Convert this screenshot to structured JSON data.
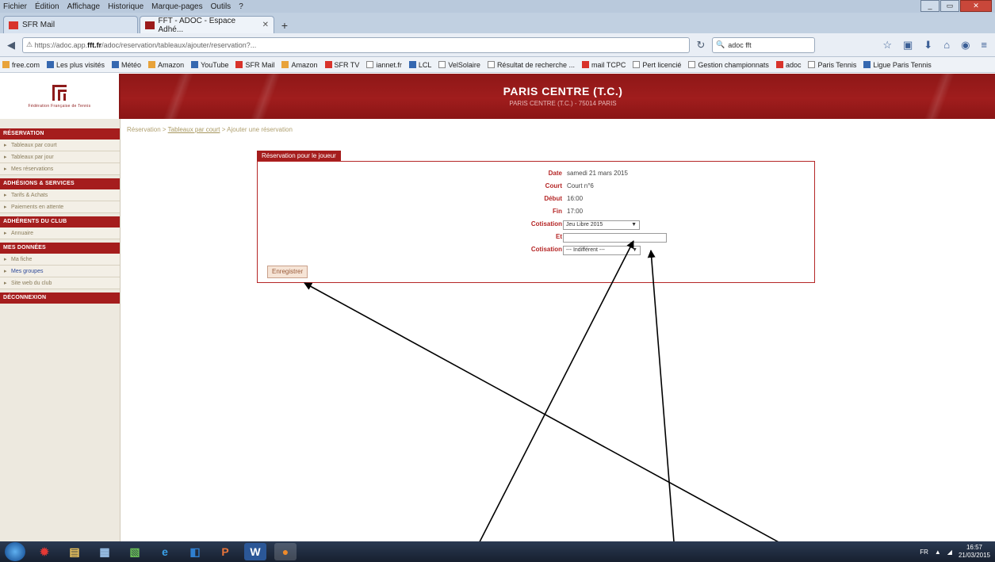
{
  "menubar": [
    "Fichier",
    "Édition",
    "Affichage",
    "Historique",
    "Marque-pages",
    "Outils",
    "?"
  ],
  "tabs": [
    {
      "label": "SFR Mail",
      "active": false
    },
    {
      "label": "FFT - ADOC - Espace Adhé...",
      "active": true
    }
  ],
  "navbar": {
    "url_host": "fft.fr",
    "url_rest": "/adoc/reservation/tableaux/ajouter/reservation?...",
    "search_value": "adoc fft"
  },
  "bookmarks": [
    {
      "label": "free.com",
      "icon": "o"
    },
    {
      "label": "Les plus visités",
      "icon": "b"
    },
    {
      "label": "Météo",
      "icon": "b"
    },
    {
      "label": "Amazon",
      "icon": "o"
    },
    {
      "label": "YouTube",
      "icon": "b"
    },
    {
      "label": "SFR Mail",
      "icon": "r"
    },
    {
      "label": "Amazon",
      "icon": "o"
    },
    {
      "label": "SFR TV",
      "icon": "r"
    },
    {
      "label": "iannet.fr",
      "icon": "g"
    },
    {
      "label": "LCL",
      "icon": "b"
    },
    {
      "label": "VelSolaire",
      "icon": "g"
    },
    {
      "label": "Résultat de recherche ...",
      "icon": "g"
    },
    {
      "label": "mail TCPC",
      "icon": "r"
    },
    {
      "label": "Pert licencié",
      "icon": "g"
    },
    {
      "label": "Gestion championnats",
      "icon": "g"
    },
    {
      "label": "adoc",
      "icon": "r"
    },
    {
      "label": "Paris Tennis",
      "icon": "g"
    },
    {
      "label": "Ligue Paris Tennis",
      "icon": "b"
    }
  ],
  "banner": {
    "title": "PARIS CENTRE (T.C.)",
    "subtitle": "PARIS CENTRE (T.C.) - 75014 PARIS"
  },
  "logo": {
    "caption": "Fédération Française de Tennis"
  },
  "breadcrumb": {
    "part1": "Réservation > ",
    "link": "Tableaux par court",
    "part2": " > Ajouter une réservation"
  },
  "sidebar": {
    "reservation_head": "RÉSERVATION",
    "reservation_items": [
      "Tableaux par court",
      "Tableaux par jour",
      "Mes réservations"
    ],
    "adhesions_head": "ADHÉSIONS & SERVICES",
    "adhesions_items": [
      "Tarifs & Achats",
      "Paiements en attente"
    ],
    "adherents_head": "ADHÉRENTS DU CLUB",
    "adherents_items": [
      "Annuaire"
    ],
    "donnees_head": "MES DONNÉES",
    "donnees_items": [
      "Ma fiche",
      "Mes groupes",
      "Site web du club"
    ],
    "logout_head": "DÉCONNEXION"
  },
  "reservation": {
    "tab_label": "Réservation pour le joueur",
    "date_label": "Date",
    "date_value": "samedi 21 mars 2015",
    "court_label": "Court",
    "court_value": "Court n°6",
    "debut_label": "Début",
    "debut_value": "16:00",
    "fin_label": "Fin",
    "fin_value": "17:00",
    "cotisation_label": "Cotisation",
    "cotisation_value": "Jeu Libre 2015",
    "et_label": "Et",
    "et_value": "",
    "cotisation2_label": "Cotisation",
    "cotisation2_value": "--- Indifférent ---",
    "save_label": "Enregistrer"
  },
  "taskbar": {
    "apps": [
      "ie",
      "explorer",
      "calc",
      "ie2",
      "outlook",
      "powerpoint",
      "word",
      "firefox"
    ],
    "lang": "FR",
    "time": "16:57",
    "date": "21/03/2015"
  }
}
